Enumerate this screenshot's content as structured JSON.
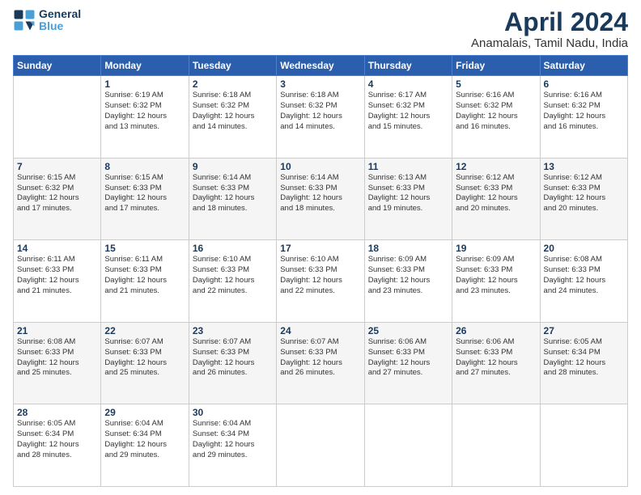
{
  "logo": {
    "line1": "General",
    "line2": "Blue"
  },
  "title": "April 2024",
  "subtitle": "Anamalais, Tamil Nadu, India",
  "days_header": [
    "Sunday",
    "Monday",
    "Tuesday",
    "Wednesday",
    "Thursday",
    "Friday",
    "Saturday"
  ],
  "weeks": [
    [
      {
        "num": "",
        "info": ""
      },
      {
        "num": "1",
        "info": "Sunrise: 6:19 AM\nSunset: 6:32 PM\nDaylight: 12 hours\nand 13 minutes."
      },
      {
        "num": "2",
        "info": "Sunrise: 6:18 AM\nSunset: 6:32 PM\nDaylight: 12 hours\nand 14 minutes."
      },
      {
        "num": "3",
        "info": "Sunrise: 6:18 AM\nSunset: 6:32 PM\nDaylight: 12 hours\nand 14 minutes."
      },
      {
        "num": "4",
        "info": "Sunrise: 6:17 AM\nSunset: 6:32 PM\nDaylight: 12 hours\nand 15 minutes."
      },
      {
        "num": "5",
        "info": "Sunrise: 6:16 AM\nSunset: 6:32 PM\nDaylight: 12 hours\nand 16 minutes."
      },
      {
        "num": "6",
        "info": "Sunrise: 6:16 AM\nSunset: 6:32 PM\nDaylight: 12 hours\nand 16 minutes."
      }
    ],
    [
      {
        "num": "7",
        "info": "Sunrise: 6:15 AM\nSunset: 6:32 PM\nDaylight: 12 hours\nand 17 minutes."
      },
      {
        "num": "8",
        "info": "Sunrise: 6:15 AM\nSunset: 6:33 PM\nDaylight: 12 hours\nand 17 minutes."
      },
      {
        "num": "9",
        "info": "Sunrise: 6:14 AM\nSunset: 6:33 PM\nDaylight: 12 hours\nand 18 minutes."
      },
      {
        "num": "10",
        "info": "Sunrise: 6:14 AM\nSunset: 6:33 PM\nDaylight: 12 hours\nand 18 minutes."
      },
      {
        "num": "11",
        "info": "Sunrise: 6:13 AM\nSunset: 6:33 PM\nDaylight: 12 hours\nand 19 minutes."
      },
      {
        "num": "12",
        "info": "Sunrise: 6:12 AM\nSunset: 6:33 PM\nDaylight: 12 hours\nand 20 minutes."
      },
      {
        "num": "13",
        "info": "Sunrise: 6:12 AM\nSunset: 6:33 PM\nDaylight: 12 hours\nand 20 minutes."
      }
    ],
    [
      {
        "num": "14",
        "info": "Sunrise: 6:11 AM\nSunset: 6:33 PM\nDaylight: 12 hours\nand 21 minutes."
      },
      {
        "num": "15",
        "info": "Sunrise: 6:11 AM\nSunset: 6:33 PM\nDaylight: 12 hours\nand 21 minutes."
      },
      {
        "num": "16",
        "info": "Sunrise: 6:10 AM\nSunset: 6:33 PM\nDaylight: 12 hours\nand 22 minutes."
      },
      {
        "num": "17",
        "info": "Sunrise: 6:10 AM\nSunset: 6:33 PM\nDaylight: 12 hours\nand 22 minutes."
      },
      {
        "num": "18",
        "info": "Sunrise: 6:09 AM\nSunset: 6:33 PM\nDaylight: 12 hours\nand 23 minutes."
      },
      {
        "num": "19",
        "info": "Sunrise: 6:09 AM\nSunset: 6:33 PM\nDaylight: 12 hours\nand 23 minutes."
      },
      {
        "num": "20",
        "info": "Sunrise: 6:08 AM\nSunset: 6:33 PM\nDaylight: 12 hours\nand 24 minutes."
      }
    ],
    [
      {
        "num": "21",
        "info": "Sunrise: 6:08 AM\nSunset: 6:33 PM\nDaylight: 12 hours\nand 25 minutes."
      },
      {
        "num": "22",
        "info": "Sunrise: 6:07 AM\nSunset: 6:33 PM\nDaylight: 12 hours\nand 25 minutes."
      },
      {
        "num": "23",
        "info": "Sunrise: 6:07 AM\nSunset: 6:33 PM\nDaylight: 12 hours\nand 26 minutes."
      },
      {
        "num": "24",
        "info": "Sunrise: 6:07 AM\nSunset: 6:33 PM\nDaylight: 12 hours\nand 26 minutes."
      },
      {
        "num": "25",
        "info": "Sunrise: 6:06 AM\nSunset: 6:33 PM\nDaylight: 12 hours\nand 27 minutes."
      },
      {
        "num": "26",
        "info": "Sunrise: 6:06 AM\nSunset: 6:33 PM\nDaylight: 12 hours\nand 27 minutes."
      },
      {
        "num": "27",
        "info": "Sunrise: 6:05 AM\nSunset: 6:34 PM\nDaylight: 12 hours\nand 28 minutes."
      }
    ],
    [
      {
        "num": "28",
        "info": "Sunrise: 6:05 AM\nSunset: 6:34 PM\nDaylight: 12 hours\nand 28 minutes."
      },
      {
        "num": "29",
        "info": "Sunrise: 6:04 AM\nSunset: 6:34 PM\nDaylight: 12 hours\nand 29 minutes."
      },
      {
        "num": "30",
        "info": "Sunrise: 6:04 AM\nSunset: 6:34 PM\nDaylight: 12 hours\nand 29 minutes."
      },
      {
        "num": "",
        "info": ""
      },
      {
        "num": "",
        "info": ""
      },
      {
        "num": "",
        "info": ""
      },
      {
        "num": "",
        "info": ""
      }
    ]
  ]
}
